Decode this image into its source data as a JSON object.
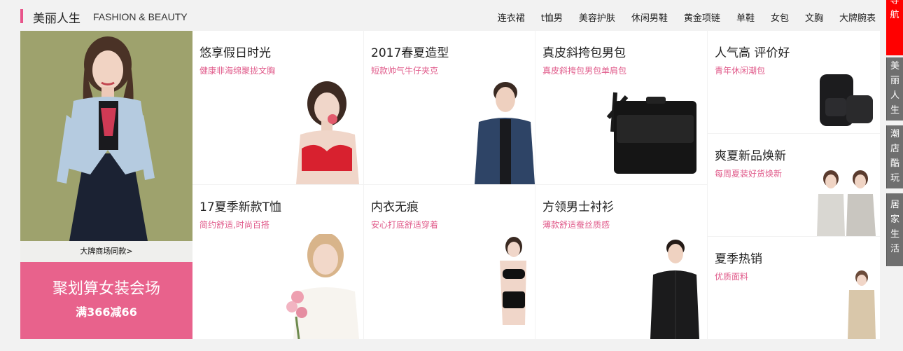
{
  "header": {
    "title": "美丽人生",
    "subtitle": "FASHION & BEAUTY",
    "nav": [
      "连衣裙",
      "t恤男",
      "美容护肤",
      "休闲男鞋",
      "黄金项链",
      "单鞋",
      "女包",
      "文胸",
      "大牌腕表"
    ]
  },
  "hero": {
    "caption": "大牌商场同款>",
    "promo_title": "聚划算女装会场",
    "promo_sub": "满366减66"
  },
  "tiles": [
    {
      "title": "悠享假日时光",
      "sub": "健康非海绵聚拢文胸"
    },
    {
      "title": "2017春夏造型",
      "sub": "短款帅气牛仔夹克"
    },
    {
      "title": "真皮斜挎包男包",
      "sub": "真皮斜挎包男包单肩包"
    },
    {
      "title": "人气高 评价好",
      "sub": "青年休闲潮包"
    },
    {
      "title": "爽夏新品焕新",
      "sub": "每周夏装好货焕新"
    },
    {
      "title": "17夏季新款T恤",
      "sub": "简约舒适,时尚百搭"
    },
    {
      "title": "内衣无痕",
      "sub": "安心打底舒适穿着"
    },
    {
      "title": "方领男士衬衫",
      "sub": "薄款舒适蚕丝质感"
    },
    {
      "title": "夏季热销",
      "sub": "优质面料"
    }
  ],
  "sidenav": {
    "top": "导航",
    "items": [
      "美丽人生",
      "潮店酷玩",
      "居家生活"
    ]
  },
  "colors": {
    "accent": "#e8548a",
    "promo": "#e8628c",
    "sub_text": "#e05a8a",
    "side_active": "#ff0000",
    "side_bg": "#6f6f6f"
  }
}
